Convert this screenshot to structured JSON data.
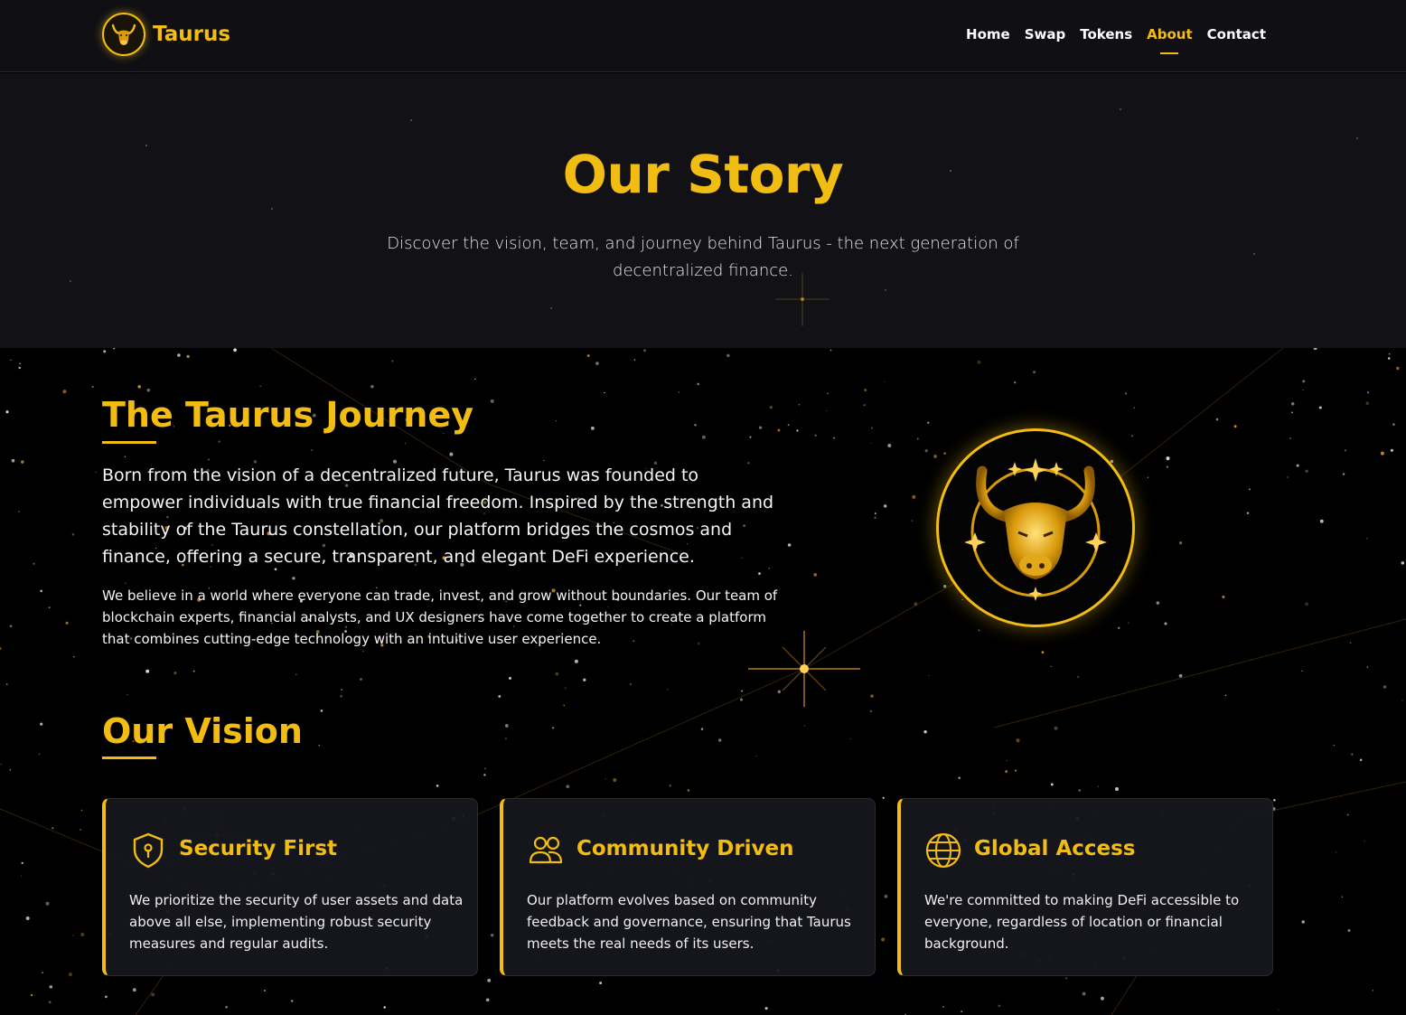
{
  "nav": {
    "brand": "Taurus",
    "links": [
      "Home",
      "Swap",
      "Tokens",
      "About",
      "Contact"
    ],
    "active": "About"
  },
  "hero": {
    "title": "Our Story",
    "subtitle": "Discover the vision, team, and journey behind Taurus - the next generation of decentralized finance."
  },
  "journey": {
    "title": "The Taurus Journey",
    "lead": "Born from the vision of a decentralized future, Taurus was founded to empower individuals with true financial freedom. Inspired by the strength and stability of the Taurus constellation, our platform bridges the cosmos and finance, offering a secure, transparent, and elegant DeFi experience.",
    "body": "We believe in a world where everyone can trade, invest, and grow without boundaries. Our team of blockchain experts, financial analysts, and UX designers have come together to create a platform that combines cutting-edge technology with an intuitive user experience."
  },
  "vision": {
    "title": "Our Vision",
    "cards": [
      {
        "icon": "shield-lock-icon",
        "title": "Security First",
        "desc": "We prioritize the security of user assets and data above all else, implementing robust security measures and regular audits."
      },
      {
        "icon": "users-icon",
        "title": "Community Driven",
        "desc": "Our platform evolves based on community feedback and governance, ensuring that Taurus meets the real needs of its users."
      },
      {
        "icon": "globe-icon",
        "title": "Global Access",
        "desc": "We're committed to making DeFi accessible to everyone, regardless of location or financial background."
      }
    ]
  },
  "colors": {
    "accent": "#f2bd12",
    "nav_bg": "#0f0f14",
    "hero_bg": "#111116",
    "page_bg": "#000000",
    "card_bg": "#16161e"
  }
}
